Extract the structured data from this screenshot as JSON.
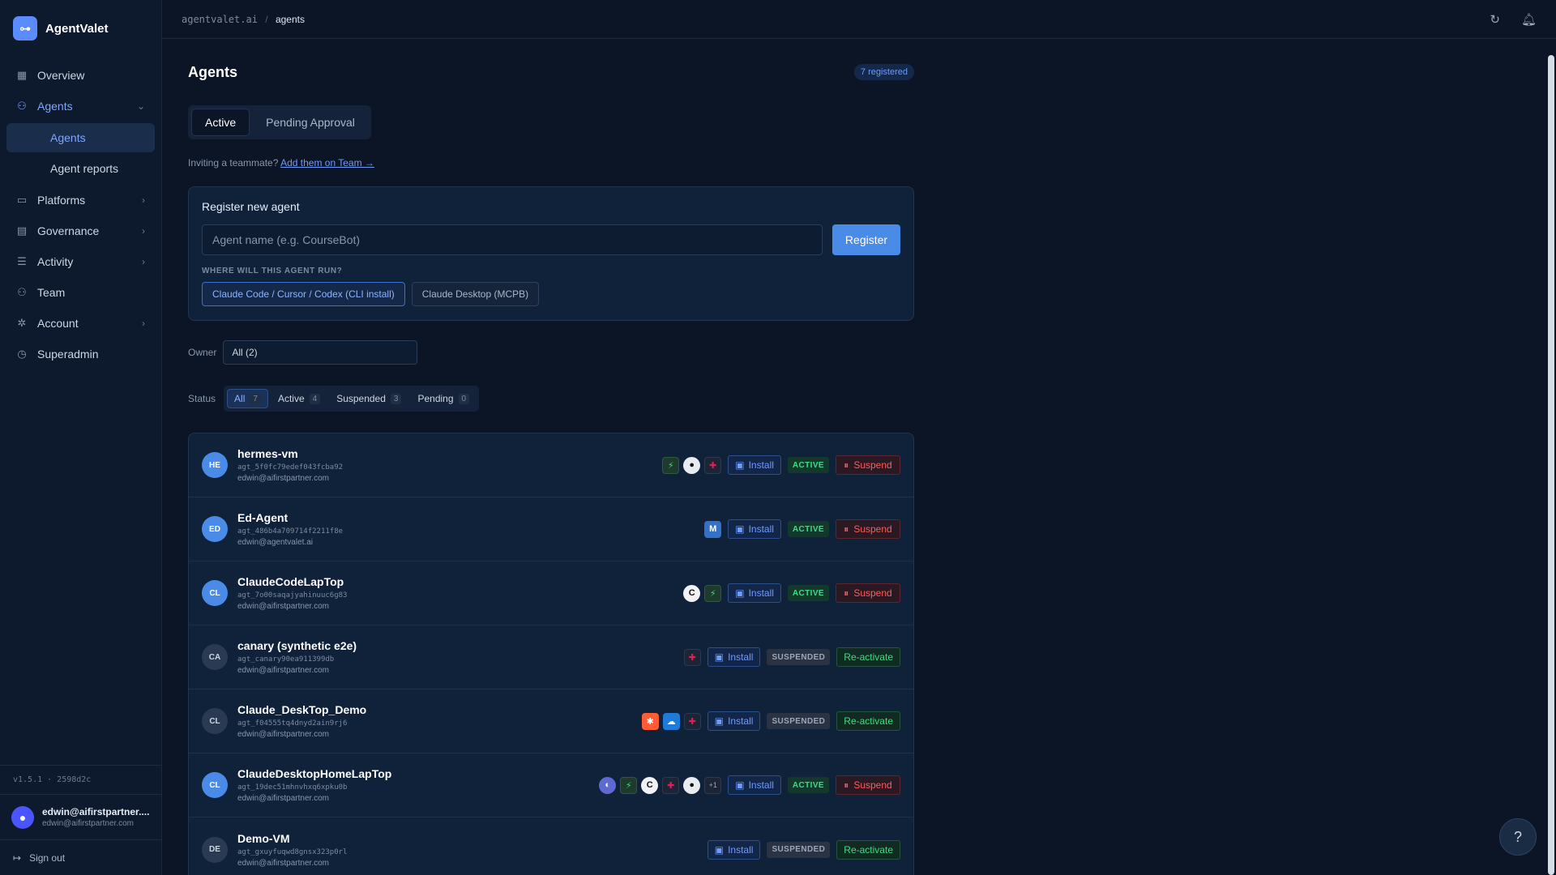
{
  "app": {
    "name": "AgentValet",
    "version": "v1.5.1 · 2598d2c"
  },
  "breadcrumb": {
    "root": "agentvalet.ai",
    "sep": "/",
    "current": "agents"
  },
  "nav": {
    "overview": "Overview",
    "agents": "Agents",
    "agents_sub": "Agents",
    "agent_reports": "Agent reports",
    "platforms": "Platforms",
    "governance": "Governance",
    "activity": "Activity",
    "team": "Team",
    "account": "Account",
    "superadmin": "Superadmin"
  },
  "user": {
    "name": "edwin@aifirstpartner....",
    "email": "edwin@aifirstpartner.com"
  },
  "signout": "Sign out",
  "page": {
    "title": "Agents",
    "count": "7 registered"
  },
  "tabs": {
    "active": "Active",
    "pending": "Pending Approval"
  },
  "invite": {
    "text": "Inviting a teammate?",
    "link": "Add them on Team →"
  },
  "register": {
    "title": "Register new agent",
    "placeholder": "Agent name (e.g. CourseBot)",
    "button": "Register",
    "run_label": "WHERE WILL THIS AGENT RUN?",
    "choice_cli": "Claude Code / Cursor / Codex (CLI install)",
    "choice_desktop": "Claude Desktop (MCPB)"
  },
  "filters": {
    "owner_label": "Owner",
    "owner_value": "All (2)",
    "status_label": "Status",
    "all": "All",
    "all_n": "7",
    "active": "Active",
    "active_n": "4",
    "suspended": "Suspended",
    "suspended_n": "3",
    "pending": "Pending",
    "pending_n": "0"
  },
  "labels": {
    "install": "Install",
    "suspend": "Suspend",
    "reactivate": "Re-activate",
    "st_active": "ACTIVE",
    "st_suspended": "SUSPENDED"
  },
  "agents": [
    {
      "initials": "HE",
      "name": "hermes-vm",
      "id": "agt_5f0fc79edef043fcba92",
      "email": "edwin@aifirstpartner.com",
      "status": "ACTIVE",
      "action": "Suspend"
    },
    {
      "initials": "ED",
      "name": "Ed-Agent",
      "id": "agt_486b4a709714f2211f8e",
      "email": "edwin@agentvalet.ai",
      "status": "ACTIVE",
      "action": "Suspend"
    },
    {
      "initials": "CL",
      "name": "ClaudeCodeLapTop",
      "id": "agt_7o00saqajyahinuuc6g83",
      "email": "edwin@aifirstpartner.com",
      "status": "ACTIVE",
      "action": "Suspend"
    },
    {
      "initials": "CA",
      "name": "canary (synthetic e2e)",
      "id": "agt_canary90ea911399db",
      "email": "edwin@aifirstpartner.com",
      "status": "SUSPENDED",
      "action": "Re-activate"
    },
    {
      "initials": "CL",
      "name": "Claude_DeskTop_Demo",
      "id": "agt_f04555tq4dnyd2ain9rj6",
      "email": "edwin@aifirstpartner.com",
      "status": "SUSPENDED",
      "action": "Re-activate"
    },
    {
      "initials": "CL",
      "name": "ClaudeDesktopHomeLapTop",
      "id": "agt_19dec51mhnvhxq6xpku0b",
      "email": "edwin@aifirstpartner.com",
      "status": "ACTIVE",
      "action": "Suspend",
      "more": "+1"
    },
    {
      "initials": "DE",
      "name": "Demo-VM",
      "id": "agt_gxuyfuqwd8gnsx323p0rl",
      "email": "edwin@aifirstpartner.com",
      "status": "SUSPENDED",
      "action": "Re-activate"
    }
  ],
  "help": "?"
}
